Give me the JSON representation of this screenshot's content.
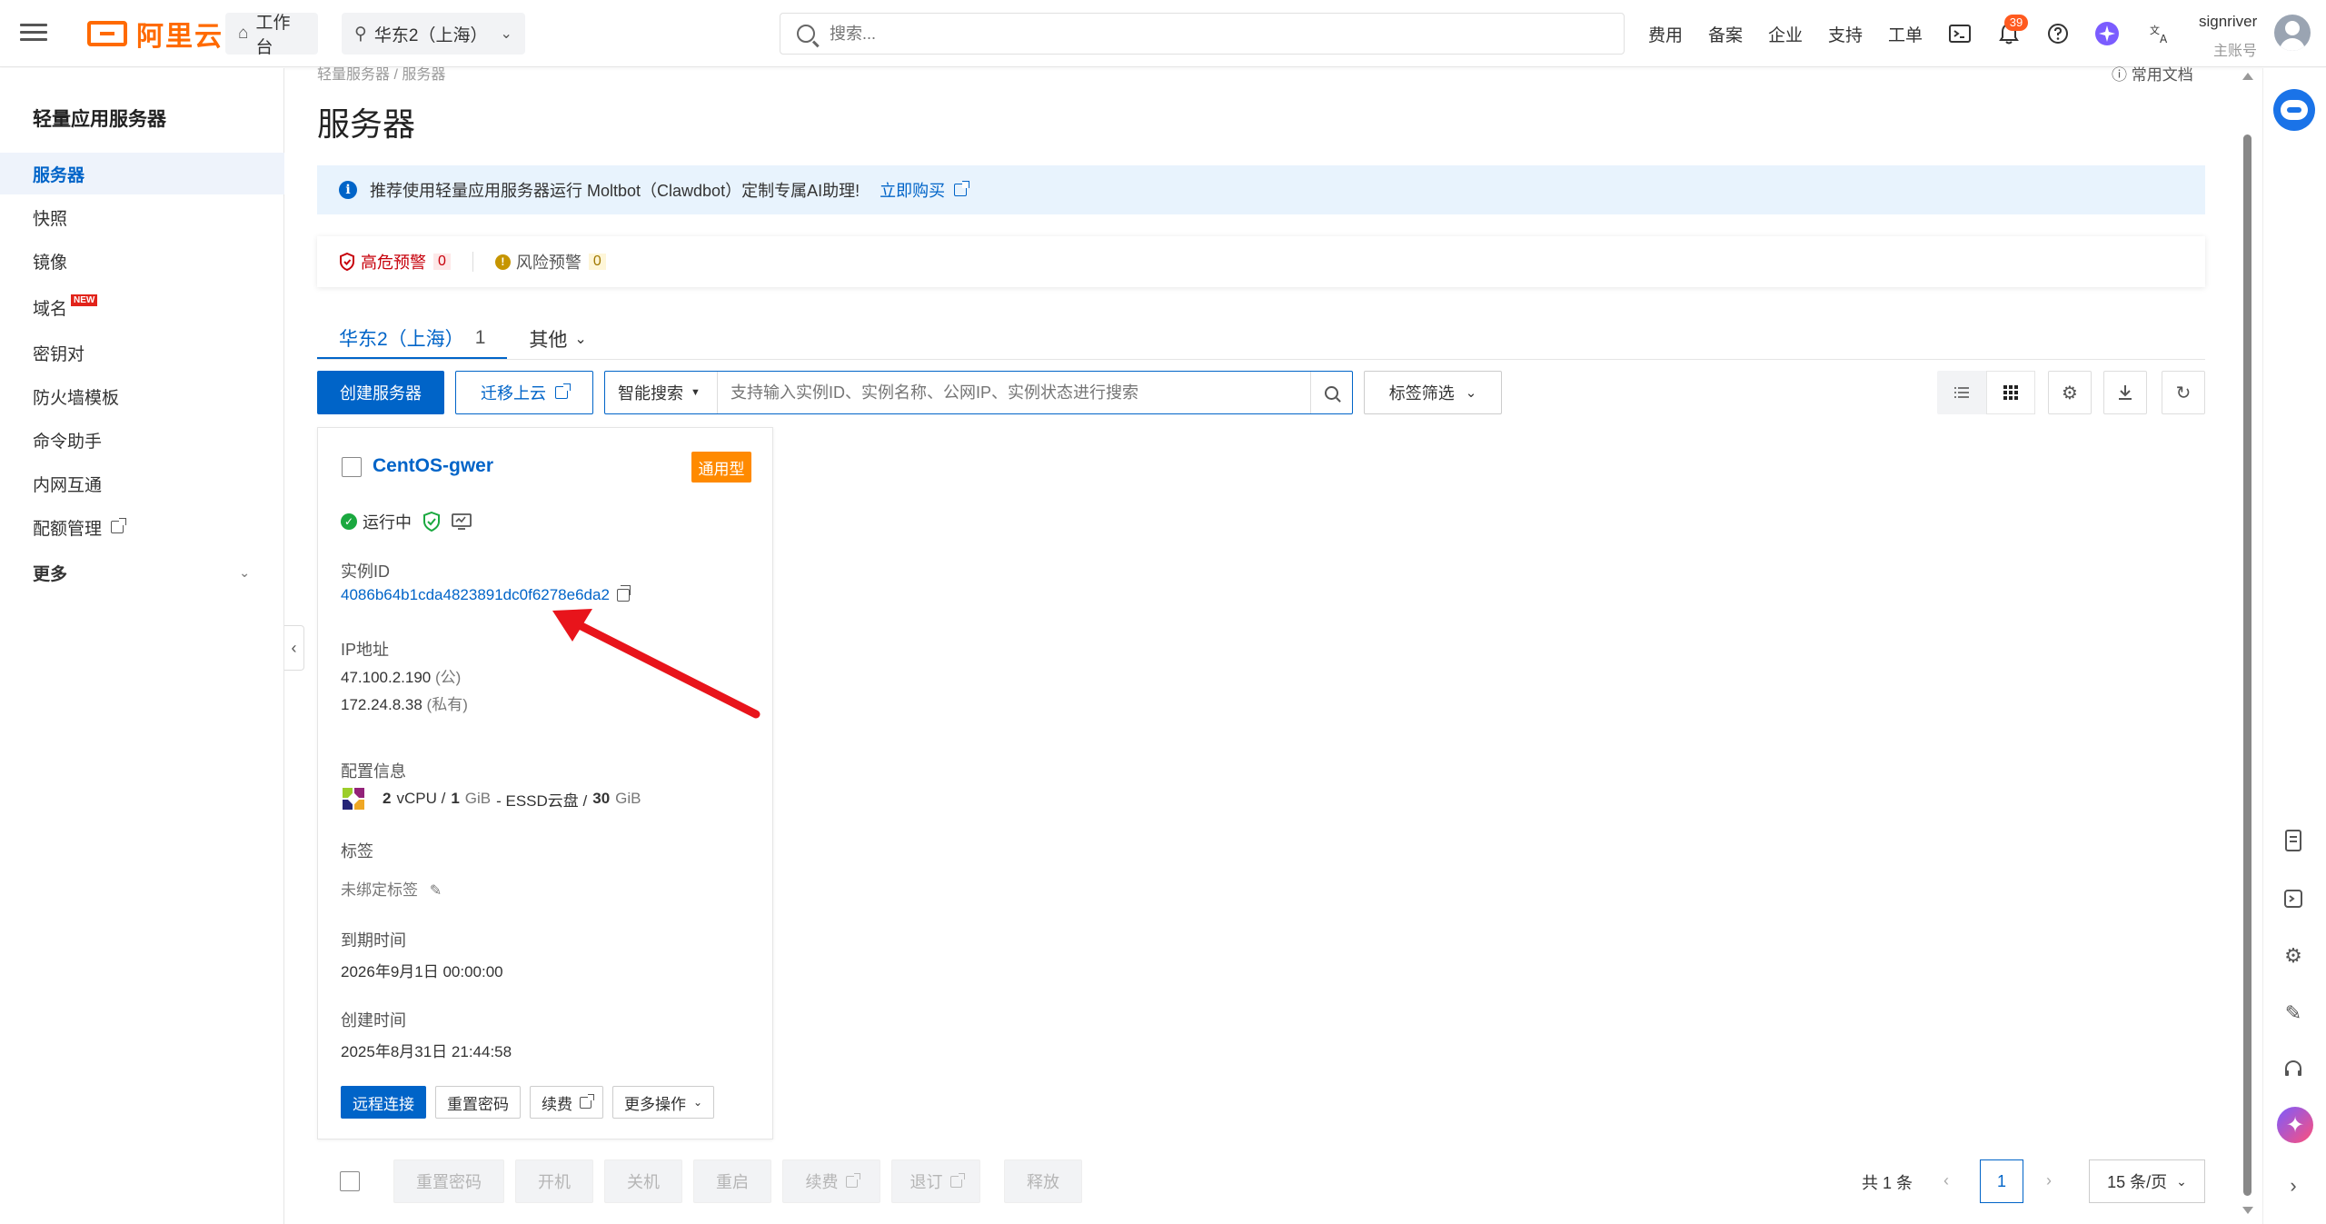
{
  "topbar": {
    "logo_text": "阿里云",
    "workbench_label": "工作台",
    "region_label": "华东2（上海）",
    "search_placeholder": "搜索...",
    "nav": [
      "费用",
      "备案",
      "企业",
      "支持",
      "工单"
    ],
    "notification_count": "39",
    "user_name": "signriver",
    "user_role": "主账号"
  },
  "sidebar": {
    "title": "轻量应用服务器",
    "items": [
      {
        "label": "服务器"
      },
      {
        "label": "快照"
      },
      {
        "label": "镜像"
      },
      {
        "label": "域名",
        "badge": "NEW"
      },
      {
        "label": "密钥对"
      },
      {
        "label": "防火墙模板"
      },
      {
        "label": "命令助手"
      },
      {
        "label": "内网互通"
      },
      {
        "label": "配额管理"
      }
    ],
    "more_label": "更多"
  },
  "main": {
    "breadcrumb": "轻量服务器 / 服务器",
    "help_doc": "常用文档",
    "page_title": "服务器",
    "notice_text": "推荐使用轻量应用服务器运行 Moltbot（Clawdbot）定制专属AI助理!",
    "notice_link": "立即购买",
    "alerts": {
      "high_label": "高危预警",
      "high_count": "0",
      "risk_label": "风险预警",
      "risk_count": "0"
    },
    "tabs": [
      {
        "label": "华东2（上海）",
        "count": "1"
      },
      {
        "label": "其他"
      }
    ],
    "toolbar": {
      "create_label": "创建服务器",
      "migrate_label": "迁移上云",
      "smart_search_label": "智能搜索",
      "search_placeholder": "支持输入实例ID、实例名称、公网IP、实例状态进行搜索",
      "tag_filter_label": "标签筛选"
    }
  },
  "card": {
    "name": "CentOS-gwer",
    "type_badge": "通用型",
    "status": "运行中",
    "instance_id_label": "实例ID",
    "instance_id": "4086b64b1cda4823891dc0f6278e6da2",
    "ip_label": "IP地址",
    "public_ip": "47.100.2.190",
    "public_tag": "(公)",
    "private_ip": "172.24.8.38",
    "private_tag": "(私有)",
    "config_label": "配置信息",
    "vcpu": "2",
    "vcpu_unit": "vCPU /",
    "mem": "1",
    "mem_unit": "GiB",
    "disk_type": "- ESSD云盘 /",
    "disk": "30",
    "disk_unit": "GiB",
    "tag_label": "标签",
    "tag_value": "未绑定标签",
    "expire_label": "到期时间",
    "expire_value": "2026年9月1日 00:00:00",
    "created_label": "创建时间",
    "created_value": "2025年8月31日 21:44:58",
    "actions": {
      "remote": "远程连接",
      "reset_pwd": "重置密码",
      "renew": "续费",
      "more": "更多操作"
    }
  },
  "bottom": {
    "buttons": [
      "重置密码",
      "开机",
      "关机",
      "重启",
      "续费",
      "退订",
      "释放"
    ],
    "total": "共 1 条",
    "page": "1",
    "page_size": "15 条/页"
  },
  "colors": {
    "primary": "#0064c8",
    "brand": "#ff6a00",
    "badge": "#ff8a00",
    "danger": "#c7000b",
    "success": "#1aa83f",
    "annotation_arrow": "#e8141b"
  }
}
